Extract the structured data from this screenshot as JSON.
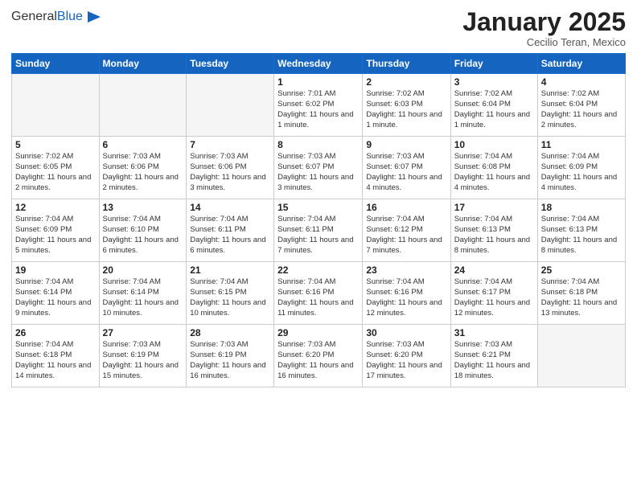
{
  "header": {
    "logo_general": "General",
    "logo_blue": "Blue",
    "title": "January 2025",
    "subtitle": "Cecilio Teran, Mexico"
  },
  "days_of_week": [
    "Sunday",
    "Monday",
    "Tuesday",
    "Wednesday",
    "Thursday",
    "Friday",
    "Saturday"
  ],
  "weeks": [
    [
      {
        "day": "",
        "sunrise": "",
        "sunset": "",
        "daylight": "",
        "empty": true
      },
      {
        "day": "",
        "sunrise": "",
        "sunset": "",
        "daylight": "",
        "empty": true
      },
      {
        "day": "",
        "sunrise": "",
        "sunset": "",
        "daylight": "",
        "empty": true
      },
      {
        "day": "1",
        "sunrise": "Sunrise: 7:01 AM",
        "sunset": "Sunset: 6:02 PM",
        "daylight": "Daylight: 11 hours and 1 minute.",
        "empty": false
      },
      {
        "day": "2",
        "sunrise": "Sunrise: 7:02 AM",
        "sunset": "Sunset: 6:03 PM",
        "daylight": "Daylight: 11 hours and 1 minute.",
        "empty": false
      },
      {
        "day": "3",
        "sunrise": "Sunrise: 7:02 AM",
        "sunset": "Sunset: 6:04 PM",
        "daylight": "Daylight: 11 hours and 1 minute.",
        "empty": false
      },
      {
        "day": "4",
        "sunrise": "Sunrise: 7:02 AM",
        "sunset": "Sunset: 6:04 PM",
        "daylight": "Daylight: 11 hours and 2 minutes.",
        "empty": false
      }
    ],
    [
      {
        "day": "5",
        "sunrise": "Sunrise: 7:02 AM",
        "sunset": "Sunset: 6:05 PM",
        "daylight": "Daylight: 11 hours and 2 minutes.",
        "empty": false
      },
      {
        "day": "6",
        "sunrise": "Sunrise: 7:03 AM",
        "sunset": "Sunset: 6:06 PM",
        "daylight": "Daylight: 11 hours and 2 minutes.",
        "empty": false
      },
      {
        "day": "7",
        "sunrise": "Sunrise: 7:03 AM",
        "sunset": "Sunset: 6:06 PM",
        "daylight": "Daylight: 11 hours and 3 minutes.",
        "empty": false
      },
      {
        "day": "8",
        "sunrise": "Sunrise: 7:03 AM",
        "sunset": "Sunset: 6:07 PM",
        "daylight": "Daylight: 11 hours and 3 minutes.",
        "empty": false
      },
      {
        "day": "9",
        "sunrise": "Sunrise: 7:03 AM",
        "sunset": "Sunset: 6:07 PM",
        "daylight": "Daylight: 11 hours and 4 minutes.",
        "empty": false
      },
      {
        "day": "10",
        "sunrise": "Sunrise: 7:04 AM",
        "sunset": "Sunset: 6:08 PM",
        "daylight": "Daylight: 11 hours and 4 minutes.",
        "empty": false
      },
      {
        "day": "11",
        "sunrise": "Sunrise: 7:04 AM",
        "sunset": "Sunset: 6:09 PM",
        "daylight": "Daylight: 11 hours and 4 minutes.",
        "empty": false
      }
    ],
    [
      {
        "day": "12",
        "sunrise": "Sunrise: 7:04 AM",
        "sunset": "Sunset: 6:09 PM",
        "daylight": "Daylight: 11 hours and 5 minutes.",
        "empty": false
      },
      {
        "day": "13",
        "sunrise": "Sunrise: 7:04 AM",
        "sunset": "Sunset: 6:10 PM",
        "daylight": "Daylight: 11 hours and 6 minutes.",
        "empty": false
      },
      {
        "day": "14",
        "sunrise": "Sunrise: 7:04 AM",
        "sunset": "Sunset: 6:11 PM",
        "daylight": "Daylight: 11 hours and 6 minutes.",
        "empty": false
      },
      {
        "day": "15",
        "sunrise": "Sunrise: 7:04 AM",
        "sunset": "Sunset: 6:11 PM",
        "daylight": "Daylight: 11 hours and 7 minutes.",
        "empty": false
      },
      {
        "day": "16",
        "sunrise": "Sunrise: 7:04 AM",
        "sunset": "Sunset: 6:12 PM",
        "daylight": "Daylight: 11 hours and 7 minutes.",
        "empty": false
      },
      {
        "day": "17",
        "sunrise": "Sunrise: 7:04 AM",
        "sunset": "Sunset: 6:13 PM",
        "daylight": "Daylight: 11 hours and 8 minutes.",
        "empty": false
      },
      {
        "day": "18",
        "sunrise": "Sunrise: 7:04 AM",
        "sunset": "Sunset: 6:13 PM",
        "daylight": "Daylight: 11 hours and 8 minutes.",
        "empty": false
      }
    ],
    [
      {
        "day": "19",
        "sunrise": "Sunrise: 7:04 AM",
        "sunset": "Sunset: 6:14 PM",
        "daylight": "Daylight: 11 hours and 9 minutes.",
        "empty": false
      },
      {
        "day": "20",
        "sunrise": "Sunrise: 7:04 AM",
        "sunset": "Sunset: 6:14 PM",
        "daylight": "Daylight: 11 hours and 10 minutes.",
        "empty": false
      },
      {
        "day": "21",
        "sunrise": "Sunrise: 7:04 AM",
        "sunset": "Sunset: 6:15 PM",
        "daylight": "Daylight: 11 hours and 10 minutes.",
        "empty": false
      },
      {
        "day": "22",
        "sunrise": "Sunrise: 7:04 AM",
        "sunset": "Sunset: 6:16 PM",
        "daylight": "Daylight: 11 hours and 11 minutes.",
        "empty": false
      },
      {
        "day": "23",
        "sunrise": "Sunrise: 7:04 AM",
        "sunset": "Sunset: 6:16 PM",
        "daylight": "Daylight: 11 hours and 12 minutes.",
        "empty": false
      },
      {
        "day": "24",
        "sunrise": "Sunrise: 7:04 AM",
        "sunset": "Sunset: 6:17 PM",
        "daylight": "Daylight: 11 hours and 12 minutes.",
        "empty": false
      },
      {
        "day": "25",
        "sunrise": "Sunrise: 7:04 AM",
        "sunset": "Sunset: 6:18 PM",
        "daylight": "Daylight: 11 hours and 13 minutes.",
        "empty": false
      }
    ],
    [
      {
        "day": "26",
        "sunrise": "Sunrise: 7:04 AM",
        "sunset": "Sunset: 6:18 PM",
        "daylight": "Daylight: 11 hours and 14 minutes.",
        "empty": false
      },
      {
        "day": "27",
        "sunrise": "Sunrise: 7:03 AM",
        "sunset": "Sunset: 6:19 PM",
        "daylight": "Daylight: 11 hours and 15 minutes.",
        "empty": false
      },
      {
        "day": "28",
        "sunrise": "Sunrise: 7:03 AM",
        "sunset": "Sunset: 6:19 PM",
        "daylight": "Daylight: 11 hours and 16 minutes.",
        "empty": false
      },
      {
        "day": "29",
        "sunrise": "Sunrise: 7:03 AM",
        "sunset": "Sunset: 6:20 PM",
        "daylight": "Daylight: 11 hours and 16 minutes.",
        "empty": false
      },
      {
        "day": "30",
        "sunrise": "Sunrise: 7:03 AM",
        "sunset": "Sunset: 6:20 PM",
        "daylight": "Daylight: 11 hours and 17 minutes.",
        "empty": false
      },
      {
        "day": "31",
        "sunrise": "Sunrise: 7:03 AM",
        "sunset": "Sunset: 6:21 PM",
        "daylight": "Daylight: 11 hours and 18 minutes.",
        "empty": false
      },
      {
        "day": "",
        "sunrise": "",
        "sunset": "",
        "daylight": "",
        "empty": true
      }
    ]
  ]
}
